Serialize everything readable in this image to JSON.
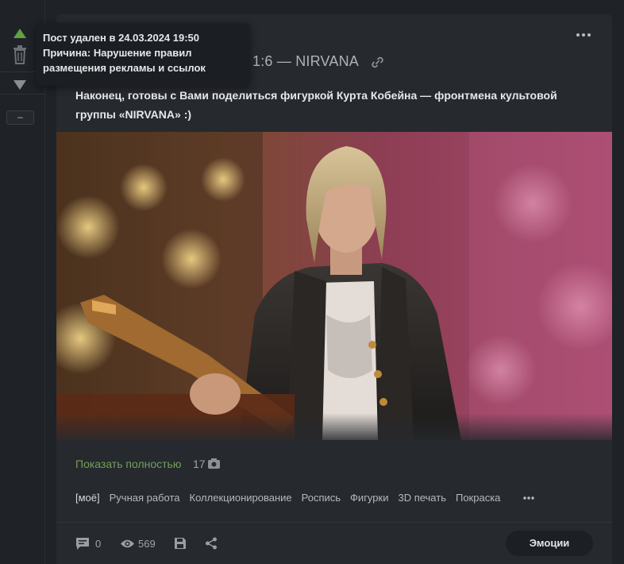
{
  "tooltip": {
    "line1": "Пост удален в 24.03.2024 19:50",
    "line2": "Причина: Нарушение правил",
    "line3": "размещения рекламы и ссылок"
  },
  "rail": {
    "collapse_label": "–"
  },
  "post": {
    "title": "1:6 — NIRVANA",
    "text": "Наконец, готовы с Вами поделиться фигуркой Курта Кобейна — фронтмена культовой группы «NIRVANA» :)",
    "show_full_label": "Показать полностью",
    "photo_count": "17",
    "tags": [
      "[моё]",
      "Ручная работа",
      "Коллекционирование",
      "Роспись",
      "Фигурки",
      "3D печать",
      "Покраска"
    ],
    "comments_count": "0",
    "views_count": "569",
    "emotions_label": "Эмоции"
  },
  "icons": {
    "vote_up": "arrow-up-icon",
    "trash": "trash-icon",
    "vote_down": "arrow-down-icon",
    "more": "more-dots-icon",
    "link": "link-icon",
    "camera": "camera-icon",
    "comment": "comment-icon",
    "eye": "eye-icon",
    "save": "save-icon",
    "share": "share-icon"
  },
  "colors": {
    "background": "#1f2227",
    "card": "#26292e",
    "accent_green": "#72a05b",
    "vote_up": "#5fa043",
    "muted_text": "#9fa3a9"
  }
}
